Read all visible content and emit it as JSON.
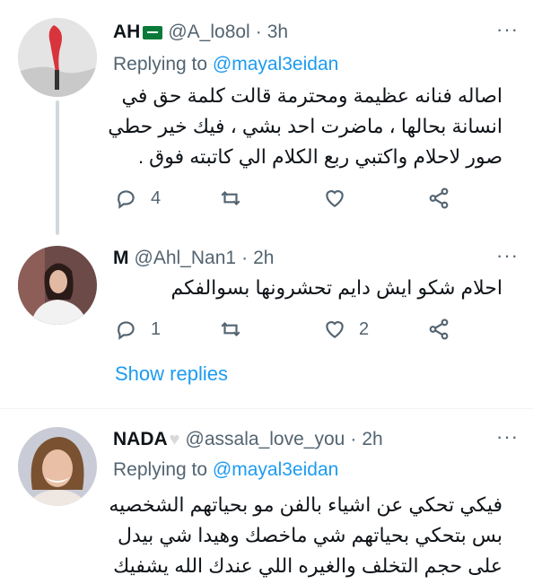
{
  "tweets": [
    {
      "name": "AH",
      "handle": "@A_lo8ol",
      "sep": "·",
      "time": "3h",
      "replying_prefix": "Replying to ",
      "replying_to": "@mayal3eidan",
      "text": [
        "اصاله فنانه عظيمة ومحترمة قالت كلمة حق في",
        "انسانة بحالها ، ماضرت احد بشي ، فيك خير حطي",
        "صور لاحلام واكتبي ربع الكلام الي كاتبته فوق ."
      ],
      "reply_count": "4",
      "retweet_count": "",
      "like_count": ""
    },
    {
      "name": "M",
      "handle": "@Ahl_Nan1",
      "sep": "·",
      "time": "2h",
      "text": [
        "احلام شكو ايش دايم تحشرونها بسوالفكم"
      ],
      "reply_count": "1",
      "retweet_count": "",
      "like_count": "2",
      "show_replies": "Show replies"
    },
    {
      "name": "NADA",
      "handle": "@assala_love_you",
      "sep": "·",
      "time": "2h",
      "replying_prefix": "Replying to ",
      "replying_to": "@mayal3eidan",
      "text": [
        "فيكي تحكي عن اشياء بالفن مو بحياتهم الشخصيه",
        "بس بتحكي بحياتهم شي ماخصك وهيدا شي بيدل",
        "على حجم التخلف والغيره  اللي عندك  الله يشفيك"
      ]
    }
  ],
  "more_glyph": "···"
}
